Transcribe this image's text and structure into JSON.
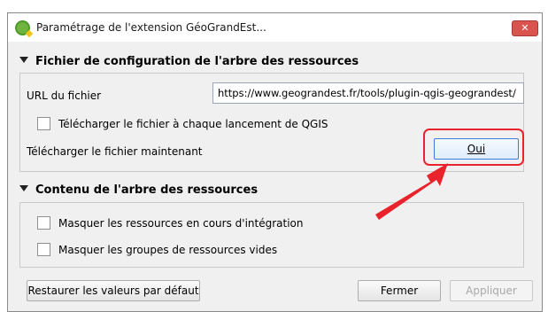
{
  "window": {
    "title": "Paramétrage de l'extension GéoGrandEst...",
    "close_label": "✕"
  },
  "sections": {
    "config": {
      "title": "Fichier de configuration de l'arbre des ressources",
      "url_label": "URL du fichier",
      "url_value": "https://www.geograndest.fr/tools/plugin-qgis-geograndest/",
      "download_each_launch_label": "Télécharger le fichier à chaque lancement de QGIS",
      "download_now_label": "Télécharger le fichier maintenant",
      "download_now_button": "Oui"
    },
    "content": {
      "title": "Contenu de l'arbre des ressources",
      "hide_integration_label": "Masquer les ressources en cours d'intégration",
      "hide_empty_groups_label": "Masquer les groupes de ressources vides"
    }
  },
  "footer": {
    "restore_label": "Restaurer les valeurs par défaut",
    "close_label": "Fermer",
    "apply_label": "Appliquer"
  },
  "colors": {
    "highlight": "#e8232b",
    "arrow": "#e8232b"
  },
  "icons": {
    "app": "qgis-icon",
    "close": "close-icon",
    "collapse": "triangle-down-icon"
  }
}
